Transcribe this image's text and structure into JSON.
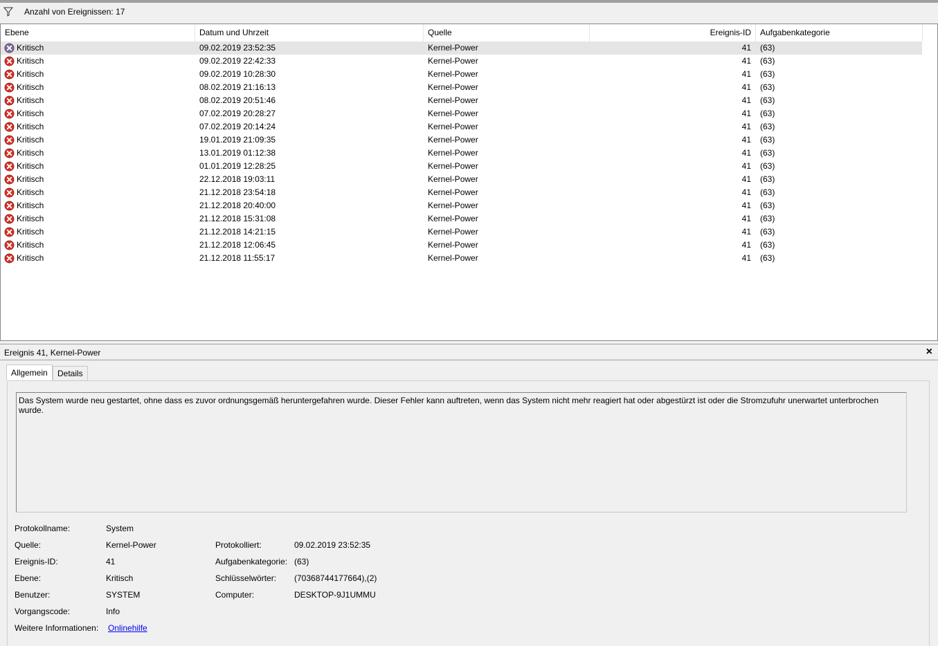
{
  "filter": {
    "icon": "filter-icon",
    "count_label": "Anzahl von Ereignissen: 17"
  },
  "columns": [
    "Ebene",
    "Datum und Uhrzeit",
    "Quelle",
    "Ereignis-ID",
    "Aufgabenkategorie"
  ],
  "events": [
    {
      "level": "Kritisch",
      "datetime": "09.02.2019 23:52:35",
      "source": "Kernel-Power",
      "id": "41",
      "category": "(63)"
    },
    {
      "level": "Kritisch",
      "datetime": "09.02.2019 22:42:33",
      "source": "Kernel-Power",
      "id": "41",
      "category": "(63)"
    },
    {
      "level": "Kritisch",
      "datetime": "09.02.2019 10:28:30",
      "source": "Kernel-Power",
      "id": "41",
      "category": "(63)"
    },
    {
      "level": "Kritisch",
      "datetime": "08.02.2019 21:16:13",
      "source": "Kernel-Power",
      "id": "41",
      "category": "(63)"
    },
    {
      "level": "Kritisch",
      "datetime": "08.02.2019 20:51:46",
      "source": "Kernel-Power",
      "id": "41",
      "category": "(63)"
    },
    {
      "level": "Kritisch",
      "datetime": "07.02.2019 20:28:27",
      "source": "Kernel-Power",
      "id": "41",
      "category": "(63)"
    },
    {
      "level": "Kritisch",
      "datetime": "07.02.2019 20:14:24",
      "source": "Kernel-Power",
      "id": "41",
      "category": "(63)"
    },
    {
      "level": "Kritisch",
      "datetime": "19.01.2019 21:09:35",
      "source": "Kernel-Power",
      "id": "41",
      "category": "(63)"
    },
    {
      "level": "Kritisch",
      "datetime": "13.01.2019 01:12:38",
      "source": "Kernel-Power",
      "id": "41",
      "category": "(63)"
    },
    {
      "level": "Kritisch",
      "datetime": "01.01.2019 12:28:25",
      "source": "Kernel-Power",
      "id": "41",
      "category": "(63)"
    },
    {
      "level": "Kritisch",
      "datetime": "22.12.2018 19:03:11",
      "source": "Kernel-Power",
      "id": "41",
      "category": "(63)"
    },
    {
      "level": "Kritisch",
      "datetime": "21.12.2018 23:54:18",
      "source": "Kernel-Power",
      "id": "41",
      "category": "(63)"
    },
    {
      "level": "Kritisch",
      "datetime": "21.12.2018 20:40:00",
      "source": "Kernel-Power",
      "id": "41",
      "category": "(63)"
    },
    {
      "level": "Kritisch",
      "datetime": "21.12.2018 15:31:08",
      "source": "Kernel-Power",
      "id": "41",
      "category": "(63)"
    },
    {
      "level": "Kritisch",
      "datetime": "21.12.2018 14:21:15",
      "source": "Kernel-Power",
      "id": "41",
      "category": "(63)"
    },
    {
      "level": "Kritisch",
      "datetime": "21.12.2018 12:06:45",
      "source": "Kernel-Power",
      "id": "41",
      "category": "(63)"
    },
    {
      "level": "Kritisch",
      "datetime": "21.12.2018 11:55:17",
      "source": "Kernel-Power",
      "id": "41",
      "category": "(63)"
    }
  ],
  "detail": {
    "title": "Ereignis 41, Kernel-Power",
    "close": "×",
    "tabs": [
      "Allgemein",
      "Details"
    ],
    "description": "Das System wurde neu gestartet, ohne dass es zuvor ordnungsgemäß heruntergefahren wurde. Dieser Fehler kann auftreten, wenn das System nicht mehr reagiert hat oder abgestürzt ist oder die Stromzufuhr unerwartet unterbrochen wurde.",
    "labels": {
      "logname": "Protokollname:",
      "source": "Quelle:",
      "eventid": "Ereignis-ID:",
      "level": "Ebene:",
      "user": "Benutzer:",
      "opcode": "Vorgangscode:",
      "moreinfo": "Weitere Informationen:",
      "logged": "Protokolliert:",
      "taskcat": "Aufgabenkategorie:",
      "keywords": "Schlüsselwörter:",
      "computer": "Computer:"
    },
    "values": {
      "logname": "System",
      "source": "Kernel-Power",
      "eventid": "41",
      "level": "Kritisch",
      "user": "SYSTEM",
      "opcode": "Info",
      "moreinfo": "Onlinehilfe",
      "logged": "09.02.2019 23:52:35",
      "taskcat": "(63)",
      "keywords": "(70368744177664),(2)",
      "computer": "DESKTOP-9J1UMMU"
    }
  },
  "colors": {
    "critical_red": "#d93025",
    "selected_row": "#e5e5e5",
    "link": "#0000ee"
  }
}
